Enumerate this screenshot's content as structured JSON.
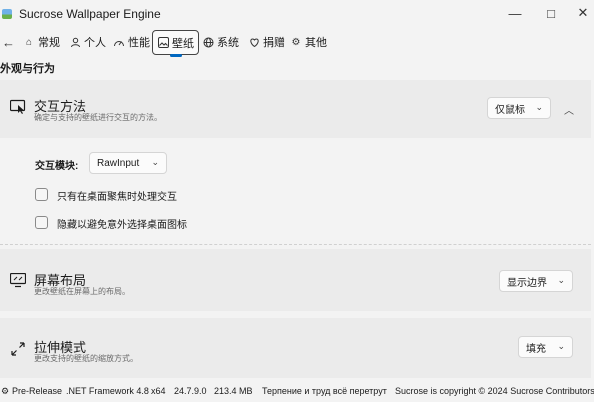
{
  "window": {
    "title": "Sucrose Wallpaper Engine",
    "controls": {
      "minimize": "—",
      "maximize": "□",
      "close": "✕"
    }
  },
  "nav": {
    "back": "←",
    "tabs": [
      {
        "label": "常规",
        "icon": "home-icon"
      },
      {
        "label": "个人",
        "icon": "person-icon"
      },
      {
        "label": "性能",
        "icon": "performance-icon"
      },
      {
        "label": "壁纸",
        "icon": "wallpaper-icon",
        "active": true
      },
      {
        "label": "系统",
        "icon": "system-icon"
      },
      {
        "label": "捐赠",
        "icon": "donate-icon"
      },
      {
        "label": "其他",
        "icon": "settings-icon"
      }
    ]
  },
  "section": {
    "title": "外观与行为"
  },
  "interaction": {
    "title": "交互方法",
    "description": "确定与支持的壁纸进行交互的方法。",
    "value": "仅鼠标",
    "module_label": "交互模块:",
    "module_value": "RawInput",
    "options": [
      {
        "label": "只有在桌面聚焦时处理交互",
        "checked": false
      },
      {
        "label": "隐藏以避免意外选择桌面图标",
        "checked": false
      }
    ]
  },
  "screen_layout": {
    "title": "屏幕布局",
    "description": "更改壁纸在屏幕上的布局。",
    "value": "显示边界"
  },
  "stretch": {
    "title": "拉伸模式",
    "description": "更改支持的壁纸的缩放方式。",
    "value": "填充"
  },
  "status": {
    "release": "Pre-Release",
    "framework": ".NET Framework 4.8",
    "arch": "x64",
    "version": "24.7.9.0",
    "memory": "213.4 MB",
    "quote": "Терпение и труд всё перетрут",
    "copyright": "Sucrose is copyright © 2024 Sucrose Contributors"
  }
}
